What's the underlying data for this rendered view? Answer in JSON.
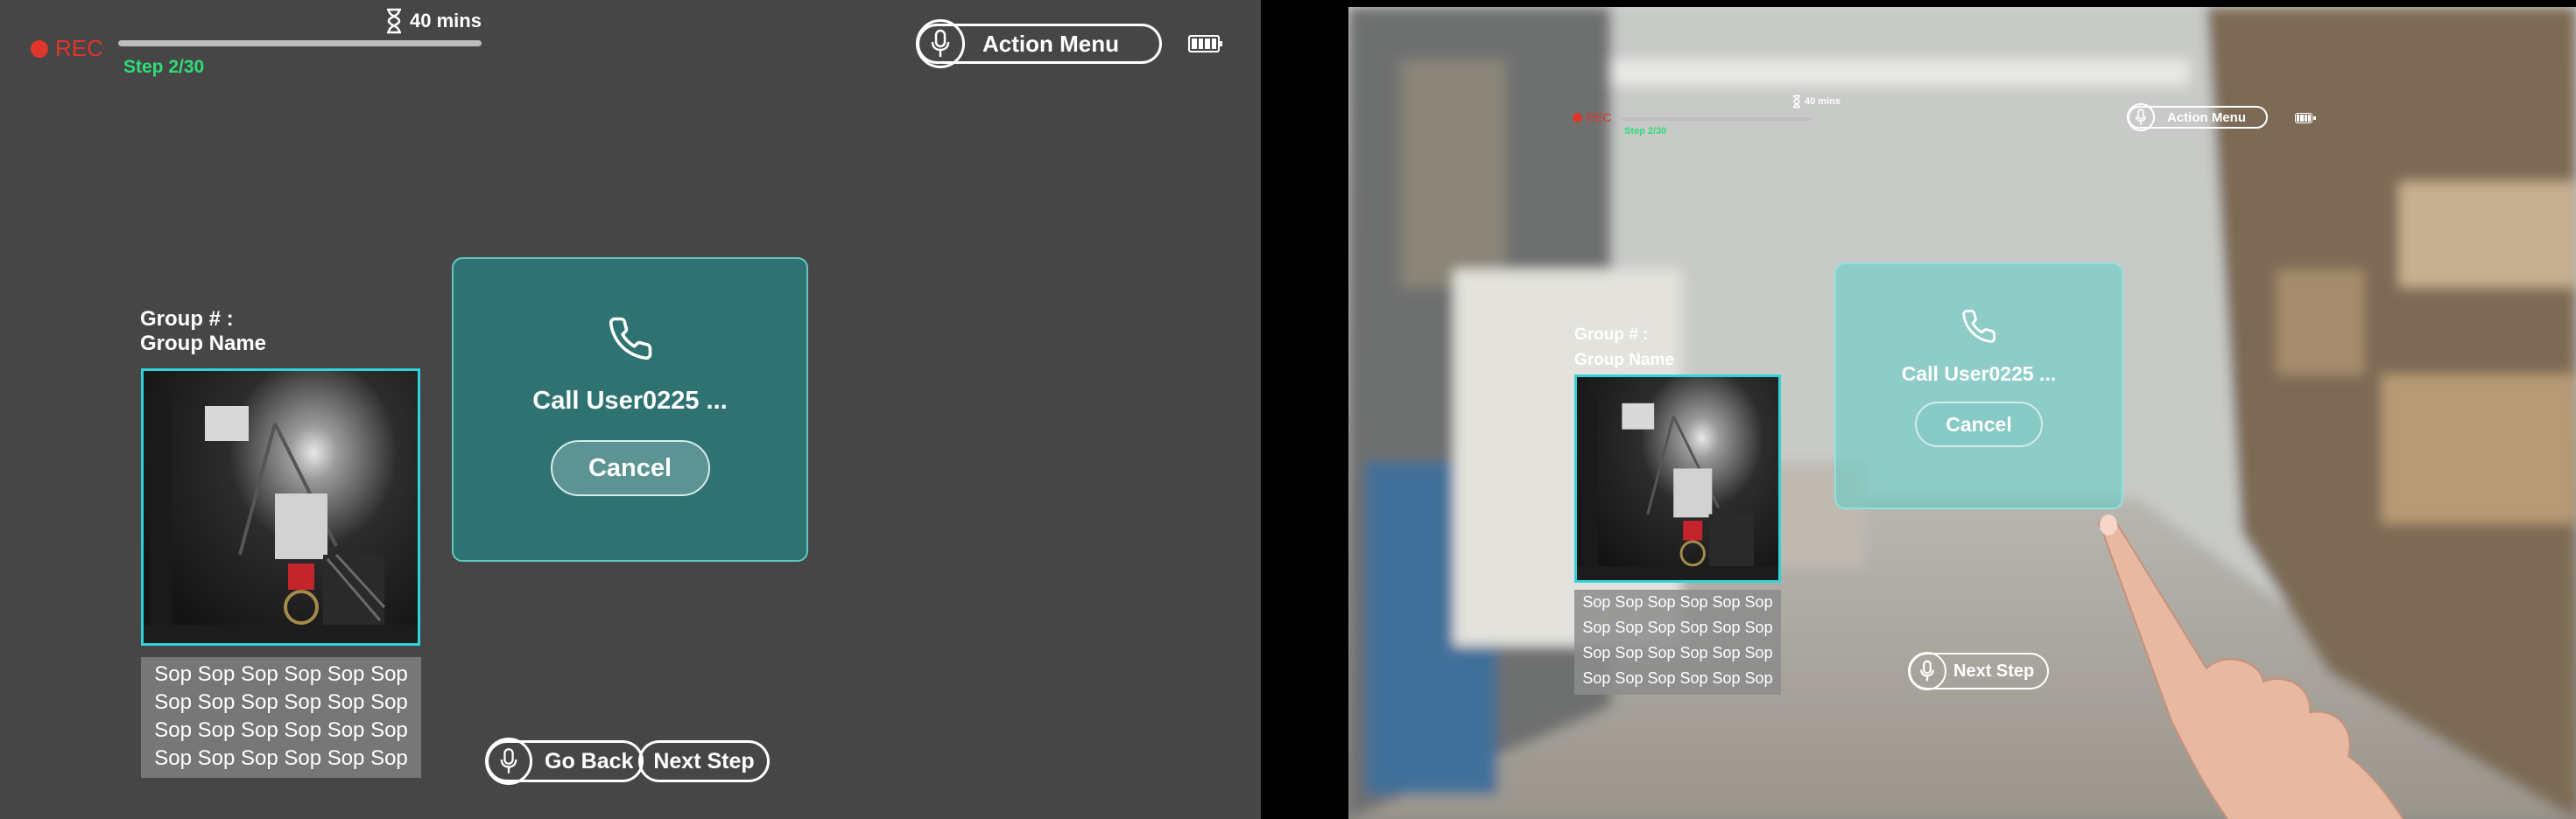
{
  "status": {
    "rec_label": "REC",
    "timer": "40 mins",
    "progress_fraction": 0.0333,
    "step": "Step 2/30",
    "action_menu": "Action Menu"
  },
  "group": {
    "line1": "Group # :",
    "line2": "Group Name"
  },
  "sop_lines": [
    "Sop Sop Sop Sop Sop Sop",
    "Sop Sop Sop Sop Sop Sop",
    "Sop Sop Sop Sop Sop Sop",
    "Sop Sop Sop Sop Sop Sop"
  ],
  "call": {
    "text": "Call User0225 ...",
    "cancel": "Cancel",
    "icon": "phone-icon"
  },
  "nav": {
    "go_back": "Go Back",
    "next_step": "Next Step"
  },
  "colors": {
    "accent": "#2fd4d9",
    "rec": "#e0352b",
    "step": "#2fdc79",
    "dialog": "#2e7372"
  }
}
